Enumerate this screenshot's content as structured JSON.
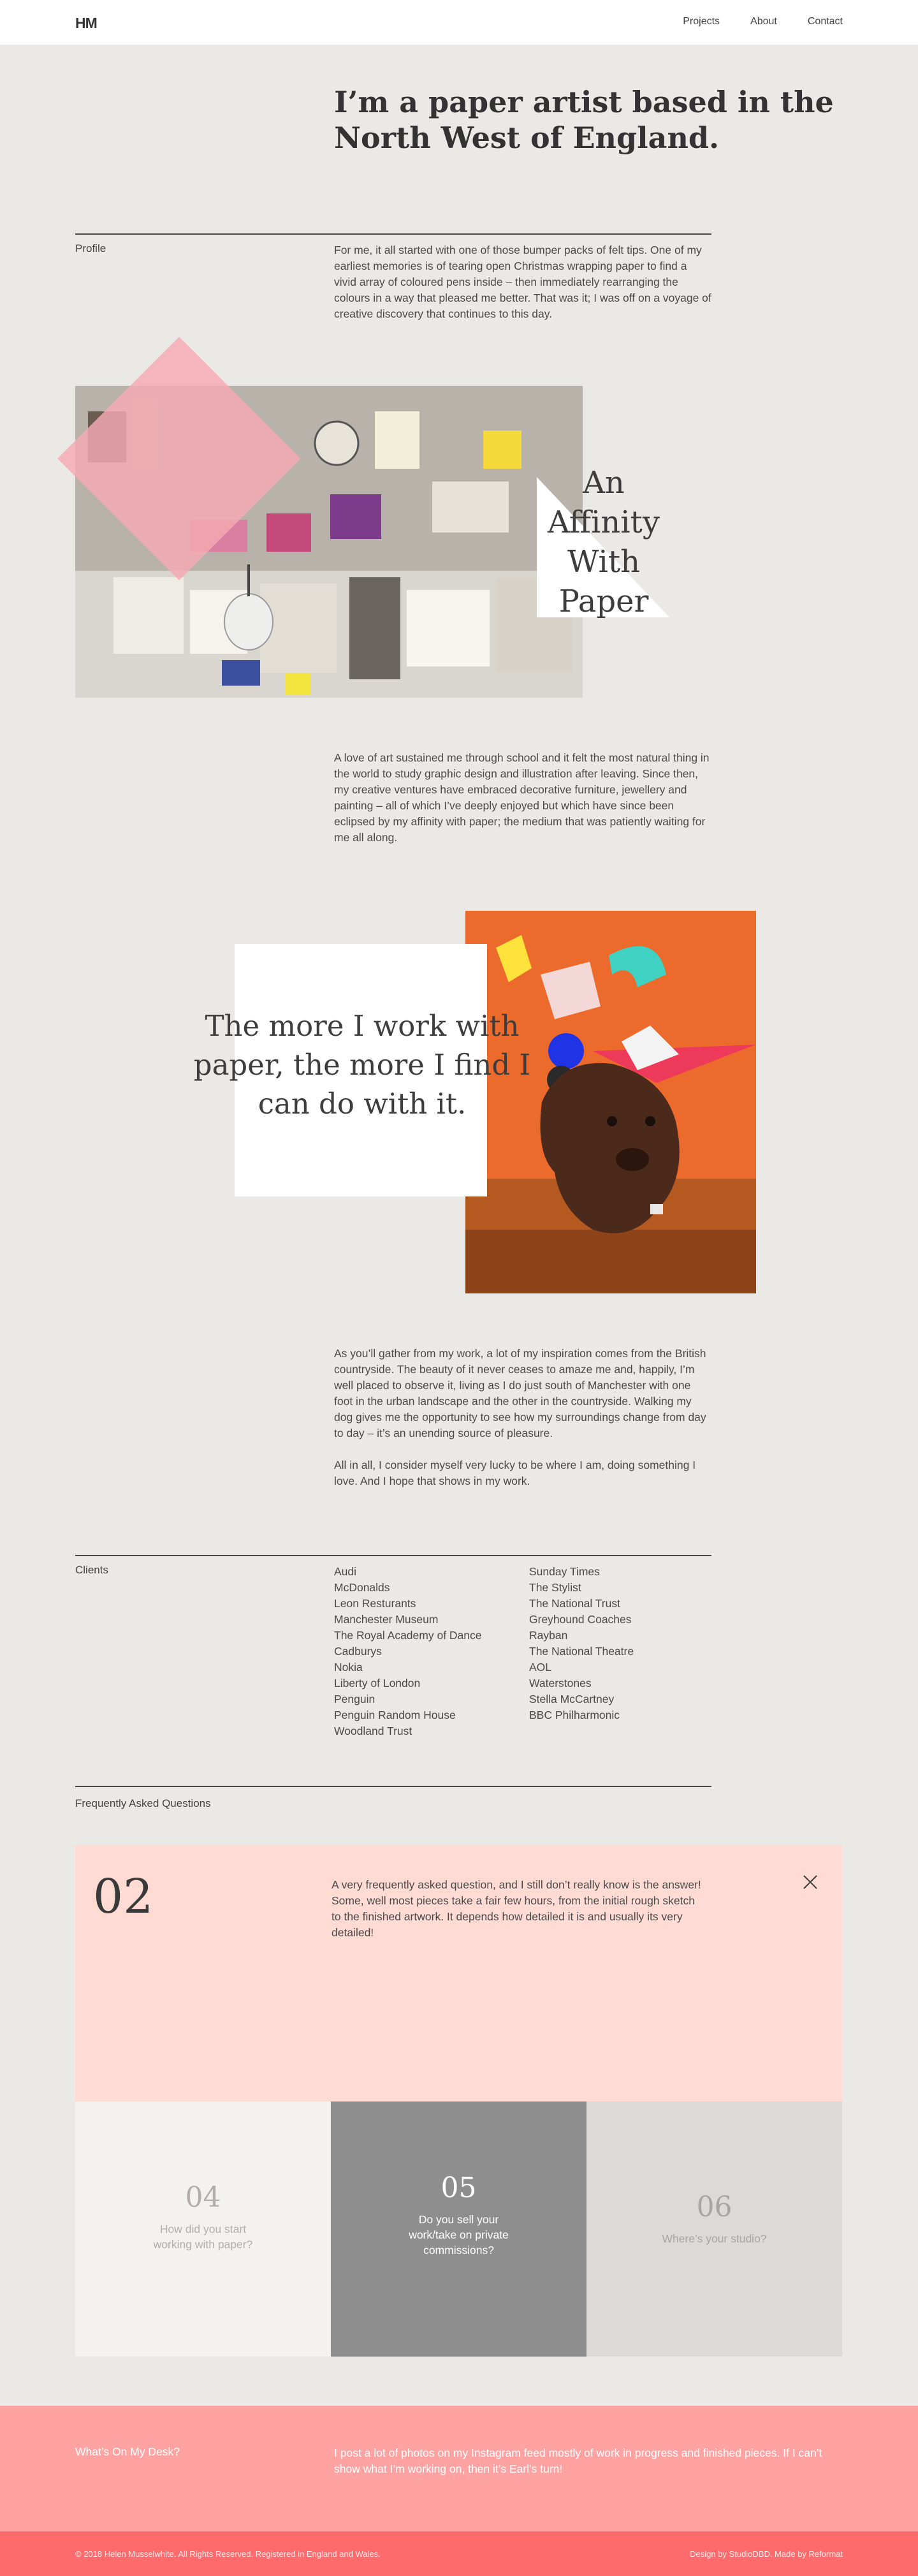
{
  "header": {
    "logo": "HM",
    "nav": [
      "Projects",
      "About",
      "Contact"
    ]
  },
  "intro": {
    "headline": "I’m a paper artist based in the North West of England."
  },
  "profile": {
    "label": "Profile",
    "text": "For me, it all started with one of those bumper packs of felt tips. One of my earliest memories is of tearing open Christmas wrapping paper to find a vivid array of coloured pens inside – then immediately rearranging the colours in a way that pleased me better. That was it; I was off on a voyage of creative discovery that continues to this day."
  },
  "collage1": {
    "heading": "An Affinity With Paper"
  },
  "story": {
    "paragraph1": "A love of art sustained me through school and it felt the most natural thing in the world to study graphic design and illustration after leaving. Since then, my creative ventures have embraced decorative furniture, jewellery and painting – all of which I’ve deeply enjoyed but which have since been eclipsed by my affinity with paper; the medium that was patiently waiting for me all along."
  },
  "quote": {
    "text": "The more I work with paper, the more I find I can do with it."
  },
  "inspiration": {
    "paragraph1": "As you’ll gather from my work, a lot of my inspiration comes from the British countryside. The beauty of it never ceases to amaze me and, happily, I’m well placed to observe it, living as I do just south of Manchester with one foot in the urban landscape and the other in the countryside. Walking my dog gives me the opportunity to see how my surroundings change from day to day – it’s an unending source of pleasure.",
    "paragraph2": "All in all, I consider myself very lucky to be where I am, doing something I love. And I hope that shows in my work."
  },
  "clients": {
    "label": "Clients",
    "col1": [
      "Audi",
      "McDonalds",
      "Leon Resturants",
      "Manchester Museum",
      "The Royal Academy of Dance",
      "Cadburys",
      "Nokia",
      "Liberty of London",
      "Penguin",
      "Penguin Random House",
      "Woodland Trust"
    ],
    "col2": [
      "Sunday Times",
      "The Stylist",
      "The National Trust",
      "Greyhound Coaches",
      "Rayban",
      "The National Theatre",
      "AOL",
      "Waterstones",
      "Stella McCartney",
      "BBC Philharmonic"
    ]
  },
  "faq": {
    "label": "Frequently Asked Questions",
    "open": {
      "number": "02",
      "answer": "A very frequently asked question, and I still don’t really know is the answer! Some, well most pieces take a fair few hours, from the initial rough sketch to the finished artwork. It depends how detailed it is and usually its very detailed!"
    },
    "cards": [
      {
        "number": "04",
        "question": "How did you start working with paper?",
        "bg": "#f3f2f1",
        "color": "#b3aeab"
      },
      {
        "number": "05",
        "question": "Do you sell your work/take on private commissions?",
        "bg": "#8e8e8e",
        "color": "#ffffff"
      },
      {
        "number": "06",
        "question": "Where’s your studio?",
        "bg": "#dbdad7",
        "color": "#a9a6a2"
      }
    ]
  },
  "desk": {
    "title": "What’s On My Desk?",
    "text": "I post a lot of photos on my Instagram feed mostly of work in progress and finished pieces. If I can’t show what I’m working on, then it’s Earl’s turn!"
  },
  "footer": {
    "left": "© 2018 Helen Musselwhite. All Rights Reserved. Registered in England and Wales.",
    "right": "Design by StudioDBD. Made by Reformat"
  },
  "colors": {
    "background": "#ebe9e6",
    "faq_open": "#ffdbd4",
    "desk": "#ffa2a2",
    "footer": "#ff6b6d",
    "dog_backdrop": "#ec6a2c"
  }
}
